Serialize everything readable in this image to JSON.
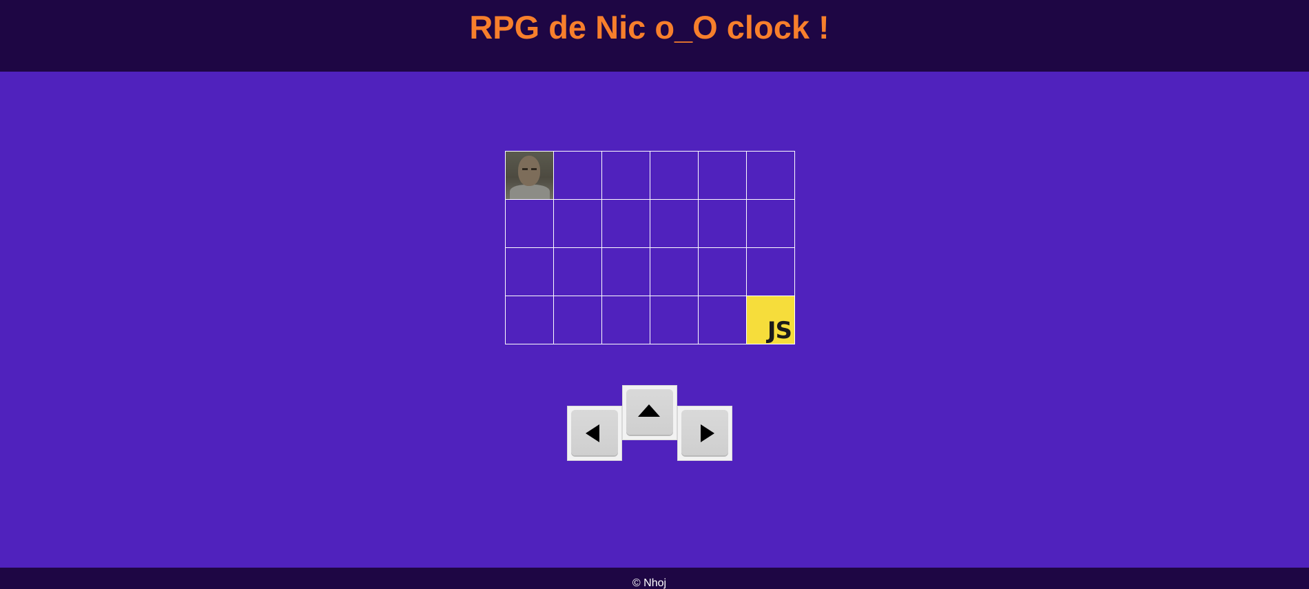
{
  "header": {
    "title": "RPG de Nic o_O clock !"
  },
  "board": {
    "rows": 4,
    "columns": 6,
    "player_position": {
      "row": 0,
      "col": 0
    },
    "player_icon": "player-portrait",
    "goal_position": {
      "row": 3,
      "col": 5
    },
    "goal_label": "JS",
    "goal_color": "#f6dd3b"
  },
  "controls": {
    "keys": [
      {
        "name": "left-arrow-key",
        "icon": "arrow-left-icon"
      },
      {
        "name": "up-arrow-key",
        "icon": "arrow-up-icon"
      },
      {
        "name": "right-arrow-key",
        "icon": "arrow-right-icon"
      }
    ]
  },
  "footer": {
    "text": "© Nhoj"
  },
  "colors": {
    "background": "#5022bd",
    "header_footer": "#1e0644",
    "title": "#f77f2c",
    "grid_lines": "#ffffff"
  }
}
